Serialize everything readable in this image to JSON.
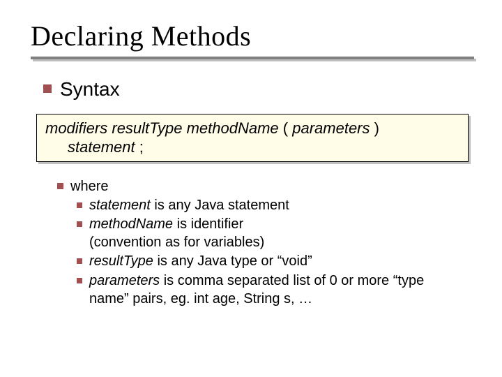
{
  "title": "Declaring Methods",
  "bullet1": "Syntax",
  "syntax": {
    "line1_modifiers": "modifiers",
    "line1_resultType": "resultType",
    "line1_methodName": "methodName",
    "line1_openParen": "( ",
    "line1_parameters": "parameters",
    "line1_closeParen": ")",
    "line2_statement": "statement",
    "line2_semi": ";"
  },
  "whereLabel": "where",
  "where": [
    {
      "italicLead": "statement",
      "rest": " is any Java statement"
    },
    {
      "italicLead": "methodName",
      "rest": " is identifier\n(convention as for variables)"
    },
    {
      "italicLead": "resultType",
      "rest": " is any Java type or “void”"
    },
    {
      "italicLead": "parameters",
      "rest": " is comma separated list of 0 or more “type name” pairs, eg. int age, String s, …"
    }
  ]
}
